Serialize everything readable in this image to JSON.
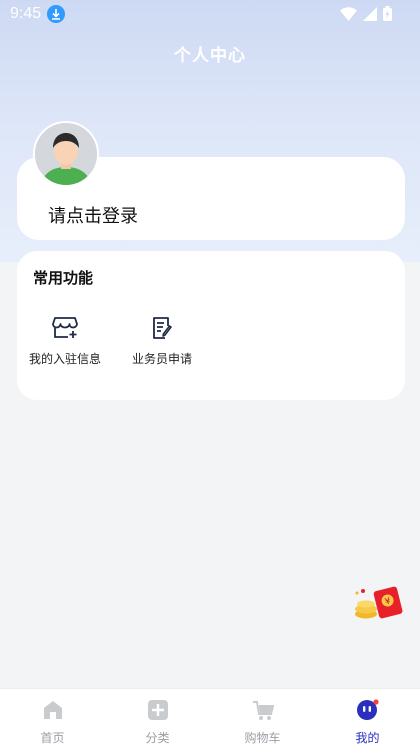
{
  "status": {
    "time": "9:45"
  },
  "header": {
    "title": "个人中心"
  },
  "profile": {
    "login_prompt": "请点击登录"
  },
  "functions": {
    "title": "常用功能",
    "items": [
      {
        "label": "我的入驻信息",
        "icon": "store-add-icon"
      },
      {
        "label": "业务员申请",
        "icon": "edit-document-icon"
      }
    ]
  },
  "tabbar": {
    "items": [
      {
        "label": "首页",
        "icon": "home-icon",
        "active": false
      },
      {
        "label": "分类",
        "icon": "category-icon",
        "active": false
      },
      {
        "label": "购物车",
        "icon": "cart-icon",
        "active": false
      },
      {
        "label": "我的",
        "icon": "profile-icon",
        "active": true
      }
    ]
  },
  "colors": {
    "accent": "#2a2fbe",
    "download_badge": "#2f9bff",
    "red_packet": "#e8202a"
  }
}
